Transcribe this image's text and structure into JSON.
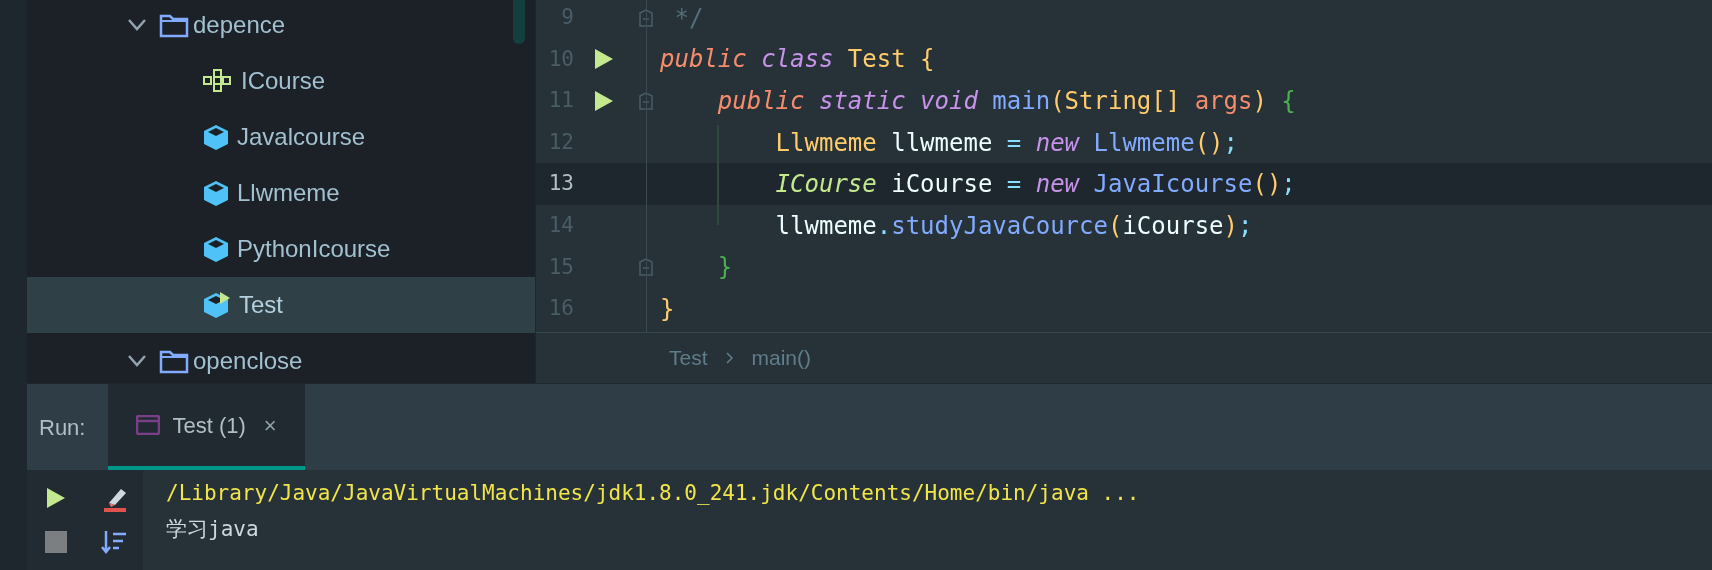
{
  "project_tree": [
    {
      "label": "depence",
      "kind": "folder",
      "expanded": true,
      "selected": false,
      "children": [
        {
          "label": "ICourse",
          "kind": "interface",
          "selected": false
        },
        {
          "label": "Javalcourse",
          "kind": "class",
          "selected": false
        },
        {
          "label": "Llwmeme",
          "kind": "class",
          "selected": false
        },
        {
          "label": "PythonIcourse",
          "kind": "class",
          "selected": false
        },
        {
          "label": "Test",
          "kind": "runnable-class",
          "selected": true
        }
      ]
    },
    {
      "label": "openclose",
      "kind": "folder",
      "expanded": true,
      "selected": false
    }
  ],
  "editor": {
    "lines": [
      {
        "number": "9",
        "fold": true,
        "current": false,
        "tokens": [
          {
            "text": " */",
            "kind": "comment"
          }
        ]
      },
      {
        "number": "10",
        "run": true,
        "current": false,
        "tokens": [
          {
            "text": "public ",
            "kind": "modifier"
          },
          {
            "text": "class",
            "kind": "keyword"
          },
          {
            "text": " Test ",
            "kind": "type"
          },
          {
            "text": "{",
            "kind": "paren"
          }
        ]
      },
      {
        "number": "11",
        "run": true,
        "fold": true,
        "current": false,
        "tokens": [
          {
            "text": "    public ",
            "kind": "modifier"
          },
          {
            "text": "static void",
            "kind": "keyword"
          },
          {
            "text": " main",
            "kind": "method"
          },
          {
            "text": "(String[] ",
            "kind": "paren"
          },
          {
            "text": "args",
            "kind": "param"
          },
          {
            "text": ") ",
            "kind": "paren"
          },
          {
            "text": "{",
            "kind": "block-brace"
          }
        ]
      },
      {
        "number": "12",
        "current": false,
        "tokens": [
          {
            "text": "        Llwmeme",
            "kind": "type"
          },
          {
            "text": " llwmeme ",
            "kind": "ident"
          },
          {
            "text": "= ",
            "kind": "operator"
          },
          {
            "text": "new",
            "kind": "keyword"
          },
          {
            "text": " Llwmeme",
            "kind": "method"
          },
          {
            "text": "()",
            "kind": "paren"
          },
          {
            "text": ";",
            "kind": "operator"
          }
        ]
      },
      {
        "number": "13",
        "current": true,
        "tokens": [
          {
            "text": "        ICourse",
            "kind": "interface"
          },
          {
            "text": " iCourse ",
            "kind": "ident"
          },
          {
            "text": "= ",
            "kind": "operator"
          },
          {
            "text": "new",
            "kind": "keyword"
          },
          {
            "text": " JavaIcourse",
            "kind": "method"
          },
          {
            "text": "()",
            "kind": "paren"
          },
          {
            "text": ";",
            "kind": "operator"
          }
        ]
      },
      {
        "number": "14",
        "current": false,
        "tokens": [
          {
            "text": "        llwmeme",
            "kind": "ident"
          },
          {
            "text": ".",
            "kind": "operator"
          },
          {
            "text": "studyJavaCource",
            "kind": "method"
          },
          {
            "text": "(",
            "kind": "paren"
          },
          {
            "text": "iCourse",
            "kind": "ident"
          },
          {
            "text": ")",
            "kind": "paren"
          },
          {
            "text": ";",
            "kind": "operator"
          }
        ]
      },
      {
        "number": "15",
        "fold": true,
        "current": false,
        "tokens": [
          {
            "text": "    }",
            "kind": "block-brace"
          }
        ]
      },
      {
        "number": "16",
        "current": false,
        "tokens": [
          {
            "text": "}",
            "kind": "paren"
          }
        ]
      }
    ],
    "breadcrumb": [
      {
        "label": "Test"
      },
      {
        "label": "main()"
      }
    ]
  },
  "run_panel": {
    "label": "Run:",
    "tabs": [
      {
        "label": "Test (1)",
        "close": "×",
        "selected": true
      }
    ],
    "output": [
      {
        "text": "/Library/Java/JavaVirtualMachines/jdk1.8.0_241.jdk/Contents/Home/bin/java ...",
        "kind": "command"
      },
      {
        "text": "学习java",
        "kind": "stdout"
      }
    ]
  }
}
